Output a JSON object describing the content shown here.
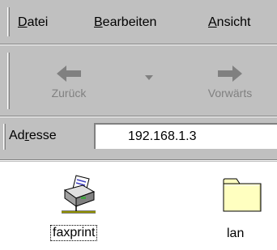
{
  "menu": {
    "items": [
      {
        "prefix": "",
        "mnemonic": "D",
        "rest": "atei"
      },
      {
        "prefix": "",
        "mnemonic": "B",
        "rest": "earbeiten"
      },
      {
        "prefix": "",
        "mnemonic": "A",
        "rest": "nsicht"
      }
    ]
  },
  "toolbar": {
    "back": {
      "label": "Zurück",
      "icon": "arrow-left-icon",
      "enabled": false
    },
    "forward": {
      "label": "Vorwärts",
      "icon": "arrow-right-icon",
      "enabled": false
    }
  },
  "address": {
    "label_before": "Ad",
    "label_mnemonic": "r",
    "label_after": "esse",
    "value": "192.168.1.3"
  },
  "items": [
    {
      "name": "faxprint",
      "icon": "network-printer-icon",
      "selected": true
    },
    {
      "name": "lan",
      "icon": "folder-icon",
      "selected": false
    }
  ],
  "colors": {
    "chrome": "#c0c0c0",
    "disabled_text": "#808080",
    "folder_fill": "#ffffc0"
  }
}
